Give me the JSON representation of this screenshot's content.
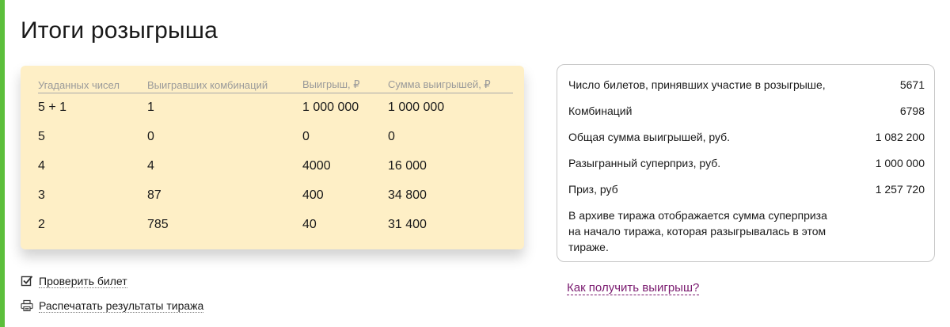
{
  "page": {
    "title": "Итоги розыгрыша"
  },
  "results": {
    "headers": [
      "Угаданных чисел",
      "Выигравших комбинаций",
      "Выигрыш, ₽",
      "Сумма выигрышей, ₽"
    ],
    "rows": [
      [
        "5 + 1",
        "1",
        "1 000 000",
        "1 000 000"
      ],
      [
        "5",
        "0",
        "0",
        "0"
      ],
      [
        "4",
        "4",
        "4000",
        "16 000"
      ],
      [
        "3",
        "87",
        "400",
        "34 800"
      ],
      [
        "2",
        "785",
        "40",
        "31 400"
      ]
    ]
  },
  "stats": {
    "items": [
      {
        "label": "Число билетов, принявших участие в розыгрыше,",
        "value": "5671"
      },
      {
        "label": "Комбинаций",
        "value": "6798"
      },
      {
        "label": "Общая сумма выигрышей, руб.",
        "value": "1 082 200"
      },
      {
        "label": "Разыгранный суперприз, руб.",
        "value": "1 000 000"
      },
      {
        "label": "Приз, руб",
        "value": "1 257 720"
      }
    ],
    "note_lines": [
      "В архиве тиража отображается сумма суперприза",
      "на начало тиража, которая разыгрывалась в этом",
      "тираже."
    ]
  },
  "actions": {
    "check_ticket": "Проверить билет",
    "print_results": "Распечатать результаты тиража"
  },
  "links": {
    "how_to_get": "Как получить выигрыш?"
  },
  "icons": {
    "check": "checkbox-icon",
    "print": "printer-icon"
  },
  "colors": {
    "accent": "#5cbf3b",
    "card": "#feefc6",
    "link": "#7a1a6f"
  }
}
